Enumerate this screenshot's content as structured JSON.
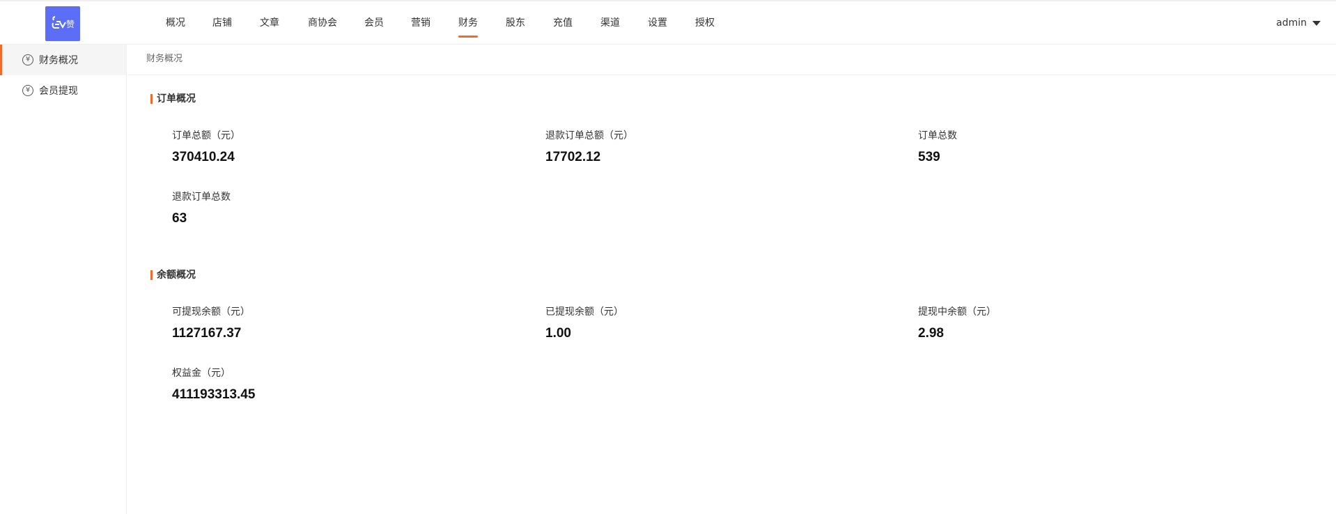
{
  "header": {
    "logo_text": "赞",
    "nav": [
      "概况",
      "店铺",
      "文章",
      "商协会",
      "会员",
      "营销",
      "财务",
      "股东",
      "充值",
      "渠道",
      "设置",
      "授权"
    ],
    "active_nav": "财务",
    "user": "admin"
  },
  "sidebar": {
    "items": [
      {
        "label": "财务概况",
        "icon": "yuan-circle-icon",
        "active": true
      },
      {
        "label": "会员提现",
        "icon": "withdraw-icon",
        "active": false
      }
    ]
  },
  "breadcrumb": "财务概况",
  "sections": {
    "orders": {
      "title": "订单概况",
      "stats": [
        {
          "label": "订单总额（元）",
          "value": "370410.24"
        },
        {
          "label": "退款订单总额（元）",
          "value": "17702.12"
        },
        {
          "label": "订单总数",
          "value": "539"
        },
        {
          "label": "退款订单总数",
          "value": "63"
        }
      ]
    },
    "balance": {
      "title": "余额概况",
      "stats": [
        {
          "label": "可提现余额（元）",
          "value": "1127167.37"
        },
        {
          "label": "已提现余额（元）",
          "value": "1.00"
        },
        {
          "label": "提现中余额（元）",
          "value": "2.98"
        },
        {
          "label": "权益金（元）",
          "value": "411193313.45"
        }
      ]
    }
  },
  "colors": {
    "accent": "#f26a29",
    "logo_bg": "#5b6ef5"
  }
}
